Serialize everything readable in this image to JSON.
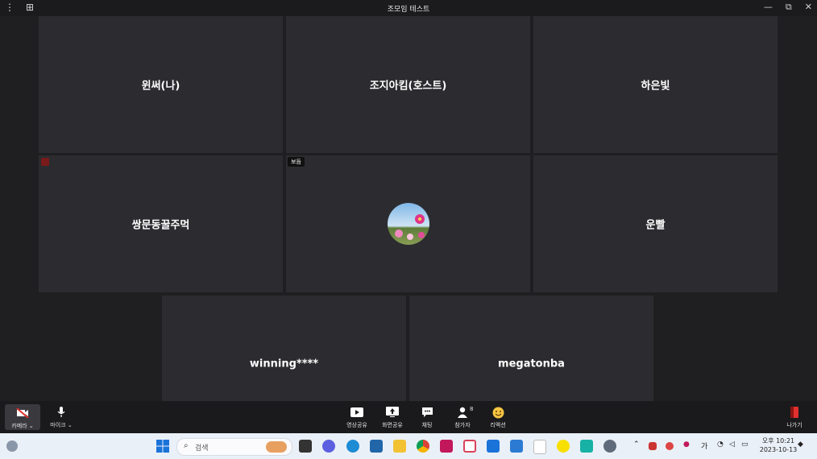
{
  "window": {
    "title": "조모임 테스트",
    "menu_icon": "⋮",
    "grid_icon": "⊞",
    "min": "—",
    "restore": "⧉",
    "close": "✕"
  },
  "tiles": [
    {
      "name": "윈써(나)"
    },
    {
      "name": "조지아킴(호스트)"
    },
    {
      "name": "하은빛"
    },
    {
      "name": "쌍문동꿀주먹"
    },
    {
      "name": "",
      "badge": "보듬"
    },
    {
      "name": "운빨"
    },
    {
      "name": "winning****"
    },
    {
      "name": "megatonba"
    }
  ],
  "toolbar": {
    "camera": "카메라",
    "mic": "마이크",
    "share_video": "영상공유",
    "share_screen": "화면공유",
    "chat": "채팅",
    "participants": "참가자",
    "participants_count": "8",
    "reactions": "리액션",
    "leave": "나가기"
  },
  "taskbar": {
    "search_placeholder": "검색",
    "ime": "가",
    "time": "오후 10:21",
    "date": "2023-10-13"
  }
}
